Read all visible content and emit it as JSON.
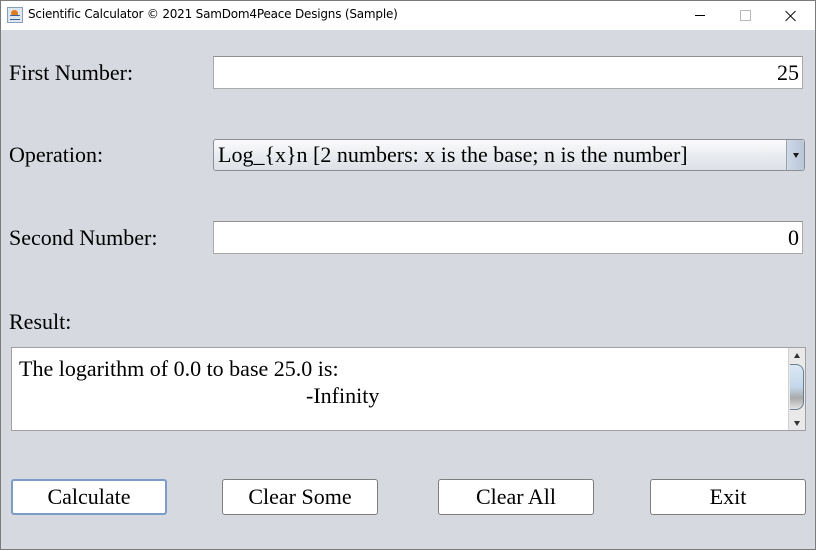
{
  "window": {
    "title": "Scientific Calculator © 2021 SamDom4Peace Designs (Sample)",
    "icon": "java-coffee-cup-icon",
    "controls": {
      "minimize": "minimize-icon",
      "maximize": "maximize-icon",
      "close": "close-icon"
    }
  },
  "form": {
    "first_number": {
      "label": "First Number:",
      "value": "25"
    },
    "operation": {
      "label": "Operation:",
      "selected": "Log_{x}n [2 numbers: x is the base; n is the number]"
    },
    "second_number": {
      "label": "Second Number:",
      "value": "0"
    },
    "result": {
      "label": "Result:",
      "line1": "The logarithm of 0.0 to base 25.0 is:",
      "line2": "-Infinity"
    }
  },
  "buttons": {
    "calculate": "Calculate",
    "clear_some": "Clear Some",
    "clear_all": "Clear All",
    "exit": "Exit"
  },
  "colors": {
    "panel_background": "#d6d9df",
    "focus_border": "#7a9cc6"
  }
}
